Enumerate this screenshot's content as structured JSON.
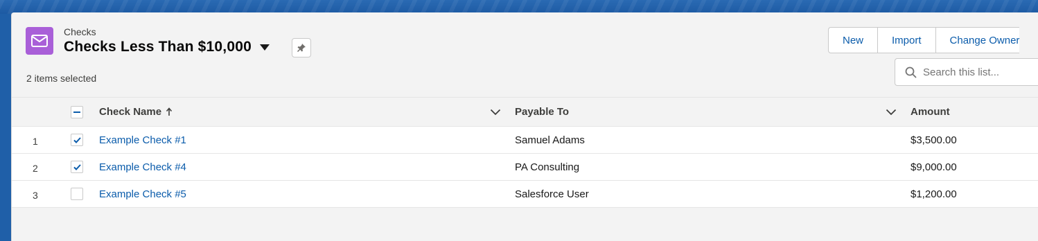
{
  "header": {
    "object_label": "Checks",
    "list_title": "Checks Less Than $10,000",
    "items_selected": "2 items selected",
    "buttons": [
      "New",
      "Import",
      "Change Owner"
    ],
    "search_placeholder": "Search this list..."
  },
  "table": {
    "columns": [
      "Check Name",
      "Payable To",
      "Amount"
    ],
    "sort_column": "Check Name",
    "rows": [
      {
        "num": "1",
        "selected": true,
        "name": "Example Check #1",
        "payable_to": "Samuel Adams",
        "amount": "$3,500.00"
      },
      {
        "num": "2",
        "selected": true,
        "name": "Example Check #4",
        "payable_to": "PA Consulting",
        "amount": "$9,000.00"
      },
      {
        "num": "3",
        "selected": false,
        "name": "Example Check #5",
        "payable_to": "Salesforce User",
        "amount": "$1,200.00"
      }
    ]
  },
  "colors": {
    "background_blue": "#1f5fa8",
    "object_icon": "#a95fd8",
    "link": "#0b5cab",
    "checkbox_check": "#0b5cab"
  },
  "icons": {
    "object": "envelope-icon",
    "pin": "pin-icon",
    "search": "search-icon",
    "sort": "arrow-up-icon",
    "column_menu": "chevron-down-icon"
  }
}
